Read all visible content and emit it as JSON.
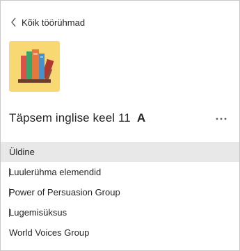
{
  "nav": {
    "back_label": "Kõik töörühmad",
    "back_icon": "chevron-left-icon"
  },
  "team": {
    "name": "Täpsem inglise keel 11",
    "name_mark": "A",
    "icon": "books-icon",
    "more_icon": "more-options-icon"
  },
  "channels": [
    {
      "label": "Üldine",
      "active": true
    },
    {
      "label": "Luulerühma elemendid",
      "active": false
    },
    {
      "label": "Power of Persuasion Group",
      "active": false
    },
    {
      "label": "Lugemisüksus",
      "active": false
    },
    {
      "label": "World Voices Group",
      "active": false
    }
  ],
  "colors": {
    "accent_tile": "#f7d873",
    "active_row": "#e8e8e8",
    "text": "#252423"
  }
}
